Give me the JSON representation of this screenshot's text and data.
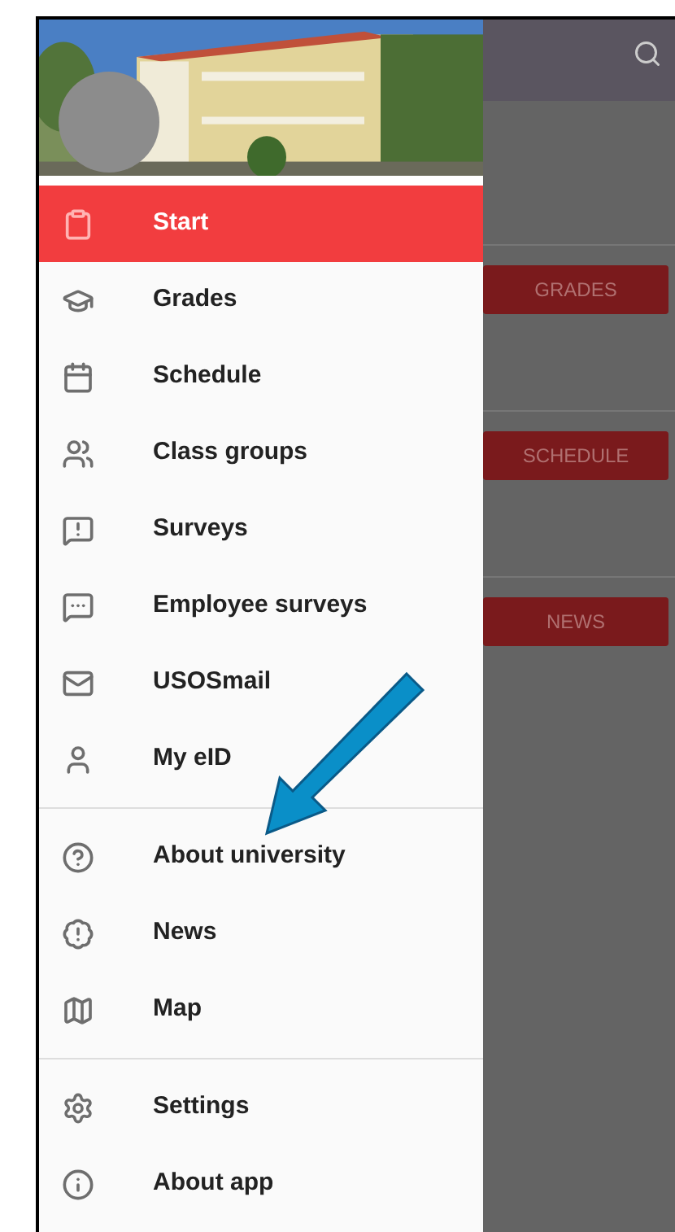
{
  "drawer": {
    "sections": [
      {
        "items": [
          {
            "label": "Start",
            "selected": true
          },
          {
            "label": "Grades",
            "selected": false
          },
          {
            "label": "Schedule",
            "selected": false
          },
          {
            "label": "Class groups",
            "selected": false
          },
          {
            "label": "Surveys",
            "selected": false
          },
          {
            "label": "Employee surveys",
            "selected": false
          },
          {
            "label": "USOSmail",
            "selected": false
          },
          {
            "label": "My eID",
            "selected": false
          }
        ]
      },
      {
        "items": [
          {
            "label": "About university",
            "selected": false
          },
          {
            "label": "News",
            "selected": false
          },
          {
            "label": "Map",
            "selected": false
          }
        ]
      },
      {
        "items": [
          {
            "label": "Settings",
            "selected": false
          },
          {
            "label": "About app",
            "selected": false
          }
        ]
      }
    ]
  },
  "background": {
    "buttons": [
      "GRADES",
      "SCHEDULE",
      "NEWS"
    ]
  }
}
